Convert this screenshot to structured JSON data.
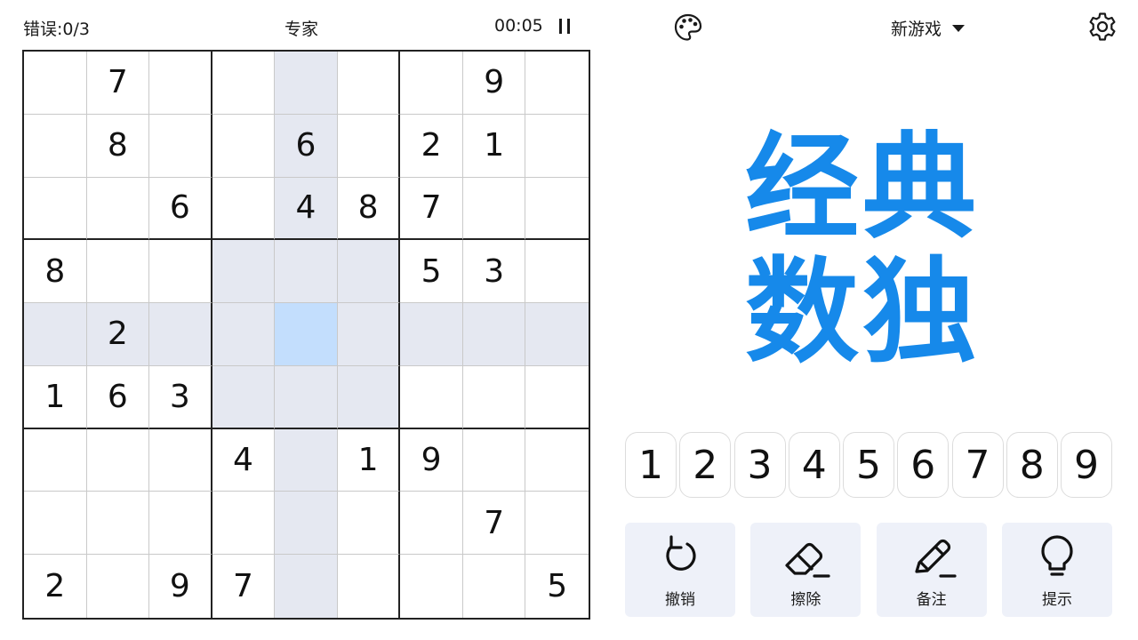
{
  "status": {
    "mistakes": "错误:0/3",
    "difficulty": "专家",
    "timer": "00:05"
  },
  "header": {
    "new_game": "新游戏"
  },
  "title": {
    "line1": "经典",
    "line2": "数独"
  },
  "board": {
    "rows": [
      [
        "",
        "7",
        "",
        "",
        "",
        "",
        "",
        "9",
        ""
      ],
      [
        "",
        "8",
        "",
        "",
        "6",
        "",
        "2",
        "1",
        ""
      ],
      [
        "",
        "",
        "6",
        "",
        "4",
        "8",
        "7",
        "",
        ""
      ],
      [
        "8",
        "",
        "",
        "",
        "",
        "",
        "5",
        "3",
        ""
      ],
      [
        "",
        "2",
        "",
        "",
        "",
        "",
        "",
        "",
        ""
      ],
      [
        "1",
        "6",
        "3",
        "",
        "",
        "",
        "",
        "",
        ""
      ],
      [
        "",
        "",
        "",
        "4",
        "",
        "1",
        "9",
        "",
        ""
      ],
      [
        "",
        "",
        "",
        "",
        "",
        "",
        "",
        "7",
        ""
      ],
      [
        "2",
        "",
        "9",
        "7",
        "",
        "",
        "",
        "",
        "5"
      ]
    ]
  },
  "numpad": {
    "keys": [
      "1",
      "2",
      "3",
      "4",
      "5",
      "6",
      "7",
      "8",
      "9"
    ]
  },
  "tools": {
    "undo": "撤销",
    "erase": "擦除",
    "notes": "备注",
    "hint": "提示"
  },
  "colors": {
    "accent": "#1689ea",
    "highlight": "#e5e8f1",
    "selected": "#c3defd",
    "tool_bg": "#eef1f9"
  },
  "icons": {
    "palette": "palette-icon",
    "settings": "gear-icon",
    "dropdown": "caret-down-icon",
    "pause": "pause-icon",
    "undo": "undo-icon",
    "erase": "eraser-icon",
    "notes": "pencil-icon",
    "hint": "lightbulb-icon"
  }
}
